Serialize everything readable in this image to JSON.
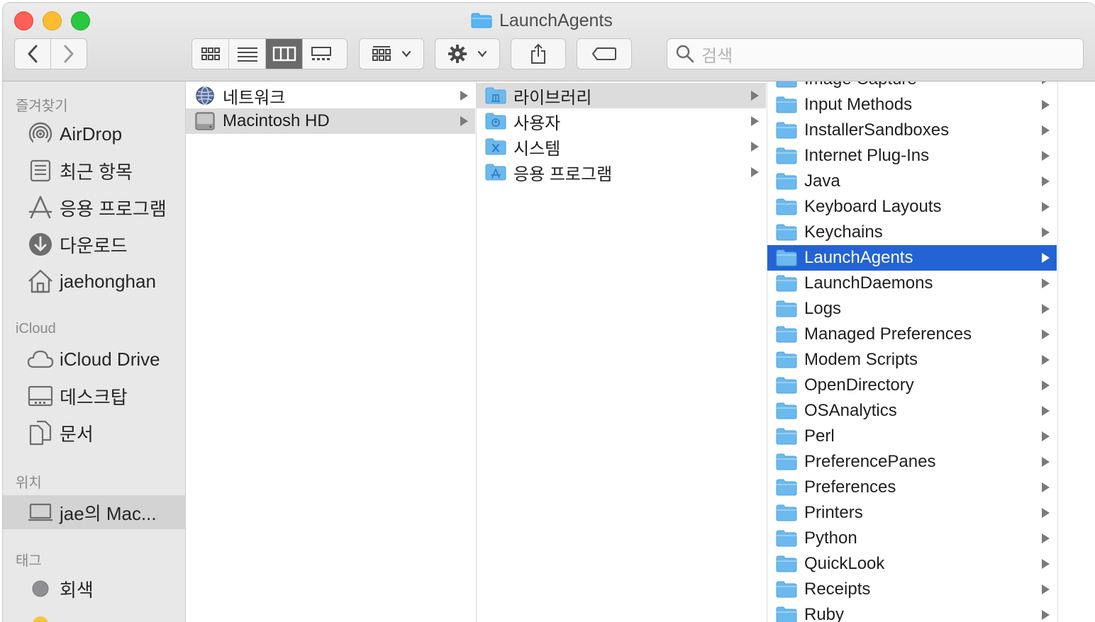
{
  "window": {
    "title": "LaunchAgents"
  },
  "toolbar": {
    "search_placeholder": "검색",
    "view_modes": [
      "icon-view",
      "list-view",
      "column-view",
      "gallery-view"
    ],
    "active_view": "column-view"
  },
  "sidebar": {
    "sections": [
      {
        "title": "즐겨찾기",
        "items": [
          {
            "label": "AirDrop",
            "icon": "airdrop-icon"
          },
          {
            "label": "최근 항목",
            "icon": "recents-icon"
          },
          {
            "label": "응용 프로그램",
            "icon": "applications-icon"
          },
          {
            "label": "다운로드",
            "icon": "downloads-icon"
          },
          {
            "label": "jaehonghan",
            "icon": "home-icon"
          }
        ]
      },
      {
        "title": "iCloud",
        "items": [
          {
            "label": "iCloud Drive",
            "icon": "cloud-icon"
          },
          {
            "label": "데스크탑",
            "icon": "desktop-icon"
          },
          {
            "label": "문서",
            "icon": "documents-icon"
          }
        ]
      },
      {
        "title": "위치",
        "items": [
          {
            "label": "jae의 Mac...",
            "icon": "laptop-icon",
            "selected": true
          }
        ]
      },
      {
        "title": "태그",
        "items": [
          {
            "label": "회색",
            "icon": "gray-tag-icon",
            "color": "#8e8e93"
          }
        ]
      }
    ]
  },
  "columns": {
    "col1": [
      {
        "label": "네트워크",
        "icon": "network-icon"
      },
      {
        "label": "Macintosh HD",
        "icon": "hard-drive-icon",
        "selected": true
      }
    ],
    "col2": [
      {
        "label": "라이브러리",
        "icon": "library-folder-icon",
        "selected": true
      },
      {
        "label": "사용자",
        "icon": "users-folder-icon"
      },
      {
        "label": "시스템",
        "icon": "system-folder-icon"
      },
      {
        "label": "응용 프로그램",
        "icon": "applications-folder-icon"
      }
    ],
    "col3": [
      {
        "label": "Image Capture"
      },
      {
        "label": "Input Methods"
      },
      {
        "label": "InstallerSandboxes"
      },
      {
        "label": "Internet Plug-Ins"
      },
      {
        "label": "Java"
      },
      {
        "label": "Keyboard Layouts"
      },
      {
        "label": "Keychains"
      },
      {
        "label": "LaunchAgents",
        "selected": true
      },
      {
        "label": "LaunchDaemons"
      },
      {
        "label": "Logs"
      },
      {
        "label": "Managed Preferences"
      },
      {
        "label": "Modem Scripts"
      },
      {
        "label": "OpenDirectory"
      },
      {
        "label": "OSAnalytics"
      },
      {
        "label": "Perl"
      },
      {
        "label": "PreferencePanes"
      },
      {
        "label": "Preferences"
      },
      {
        "label": "Printers"
      },
      {
        "label": "Python"
      },
      {
        "label": "QuickLook"
      },
      {
        "label": "Receipts"
      },
      {
        "label": "Ruby"
      }
    ]
  },
  "colors": {
    "selection_blue": "#2463d6",
    "folder_blue": "#5ab4f2"
  }
}
